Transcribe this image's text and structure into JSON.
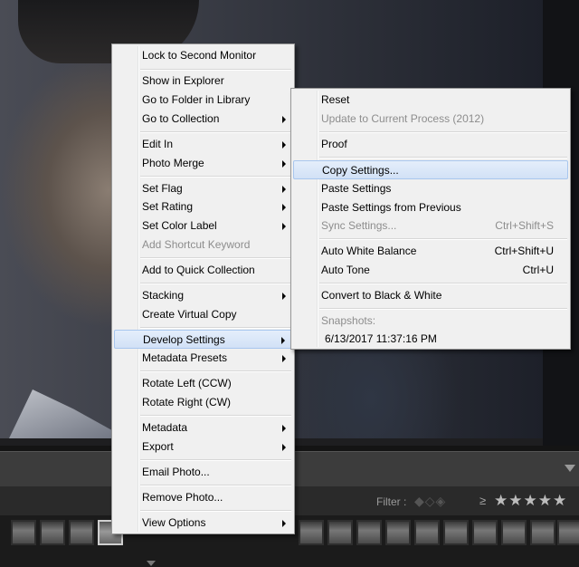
{
  "main_menu": {
    "lock_second_monitor": "Lock to Second Monitor",
    "show_in_explorer": "Show in Explorer",
    "go_to_folder": "Go to Folder in Library",
    "go_to_collection": "Go to Collection",
    "edit_in": "Edit In",
    "photo_merge": "Photo Merge",
    "set_flag": "Set Flag",
    "set_rating": "Set Rating",
    "set_color_label": "Set Color Label",
    "add_shortcut_keyword": "Add Shortcut Keyword",
    "add_quick_collection": "Add to Quick Collection",
    "stacking": "Stacking",
    "create_virtual_copy": "Create Virtual Copy",
    "develop_settings": "Develop Settings",
    "metadata_presets": "Metadata Presets",
    "rotate_left": "Rotate Left (CCW)",
    "rotate_right": "Rotate Right (CW)",
    "metadata": "Metadata",
    "export": "Export",
    "email_photo": "Email Photo...",
    "remove_photo": "Remove Photo...",
    "view_options": "View Options"
  },
  "sub_menu": {
    "reset": "Reset",
    "update_process": "Update to Current Process (2012)",
    "proof": "Proof",
    "copy_settings": "Copy Settings...",
    "paste_settings": "Paste Settings",
    "paste_from_previous": "Paste Settings from Previous",
    "sync_settings": "Sync Settings...",
    "sync_shortcut": "Ctrl+Shift+S",
    "auto_white_balance": "Auto White Balance",
    "awb_shortcut": "Ctrl+Shift+U",
    "auto_tone": "Auto Tone",
    "auto_tone_shortcut": "Ctrl+U",
    "convert_bw": "Convert to Black & White",
    "snapshots_label": "Snapshots:",
    "snapshot_1": "6/13/2017 11:37:16 PM"
  },
  "filter_bar": {
    "label": "Filter :",
    "flags": "◆◇◈",
    "gte": "≥",
    "stars": "★★★★★"
  },
  "icons": {
    "submenu_arrow": "chevron-right-icon",
    "flag": "flag-icon",
    "star": "star-icon"
  },
  "colors": {
    "menu_bg": "#f0f0f0",
    "highlight": "#d2e1f6",
    "disabled_text": "#8d8d8d"
  }
}
